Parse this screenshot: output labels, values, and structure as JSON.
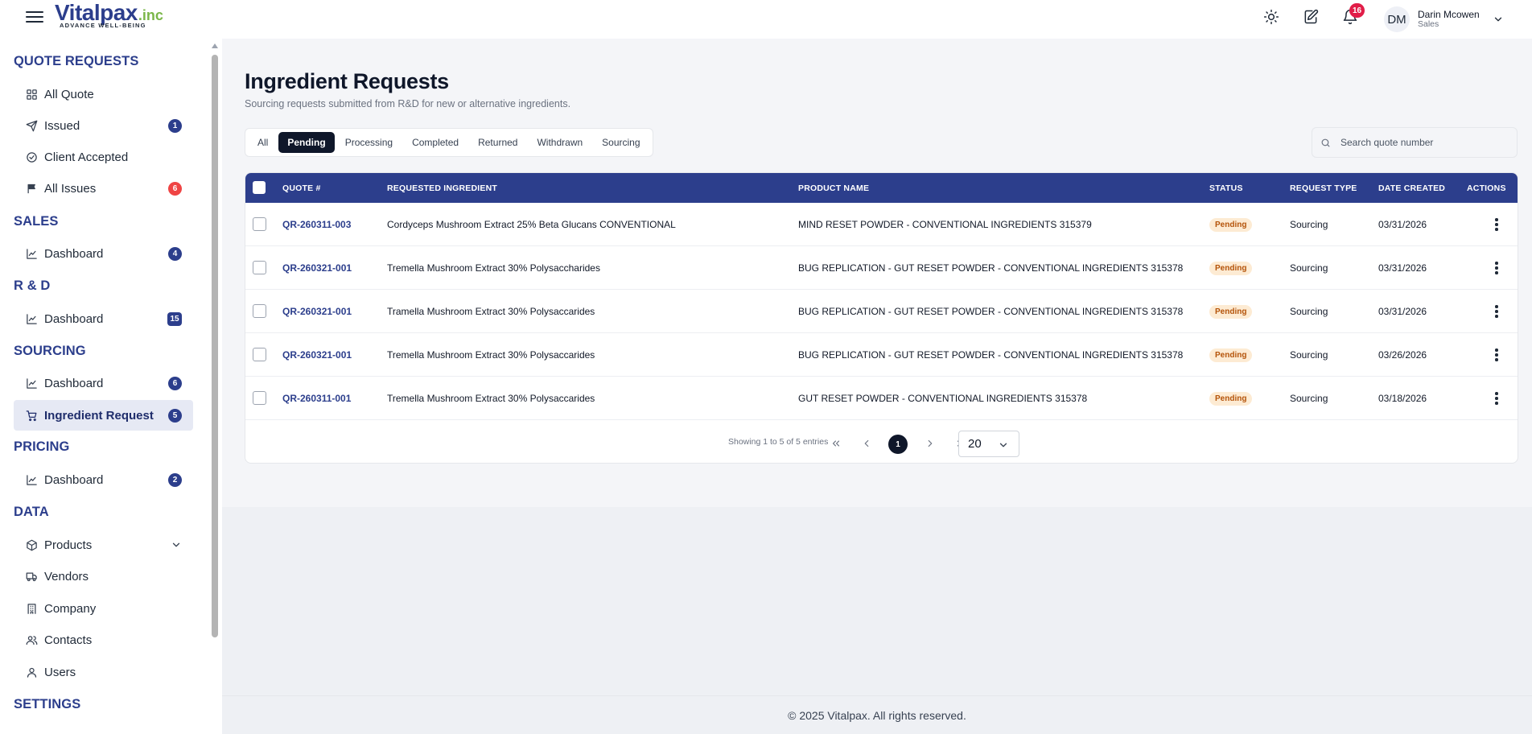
{
  "header": {
    "logo_text": "Vitalpax",
    "logo_suffix": ".inc",
    "logo_tagline": "ADVANCE WELL-BEING",
    "notifications_count": "16",
    "user_initials": "DM",
    "user_name": "Darin Mcowen",
    "user_role": "Sales"
  },
  "sidebar": {
    "sections": [
      {
        "title": "QUOTE REQUESTS"
      },
      {
        "title": "SALES"
      },
      {
        "title": "R & D"
      },
      {
        "title": "SOURCING"
      },
      {
        "title": "PRICING"
      },
      {
        "title": "DATA"
      },
      {
        "title": "SETTINGS"
      }
    ],
    "items": [
      {
        "label": "All Quote",
        "icon": "grid-icon"
      },
      {
        "label": "Issued",
        "icon": "send-icon",
        "badge": "1"
      },
      {
        "label": "Client Accepted",
        "icon": "check-circle-icon"
      },
      {
        "label": "All Issues",
        "icon": "flag-icon",
        "badge": "6"
      },
      {
        "label": "Dashboard",
        "icon": "chart-line-icon",
        "badge": "4"
      },
      {
        "label": "Dashboard",
        "icon": "chart-line-icon",
        "badge": "15"
      },
      {
        "label": "Dashboard",
        "icon": "chart-line-icon",
        "badge": "6"
      },
      {
        "label": "Ingredient Request",
        "icon": "cart-icon",
        "badge": "5"
      },
      {
        "label": "Dashboard",
        "icon": "chart-line-icon",
        "badge": "2"
      },
      {
        "label": "Products",
        "icon": "box-icon"
      },
      {
        "label": "Vendors",
        "icon": "truck-icon"
      },
      {
        "label": "Company",
        "icon": "building-icon"
      },
      {
        "label": "Contacts",
        "icon": "users-icon"
      },
      {
        "label": "Users",
        "icon": "user-icon"
      }
    ]
  },
  "main": {
    "title": "Ingredient Requests",
    "subtitle": "Sourcing requests submitted from R&D for new or alternative ingredients.",
    "tabs": [
      "All",
      "Pending",
      "Processing",
      "Completed",
      "Returned",
      "Withdrawn",
      "Sourcing"
    ],
    "active_tab": "Pending",
    "search_placeholder": "Search quote number",
    "columns": {
      "quote": "QUOTE #",
      "ingredient": "REQUESTED INGREDIENT",
      "product": "PRODUCT NAME",
      "status": "STATUS",
      "request_type": "REQUEST TYPE",
      "date_created": "DATE CREATED",
      "actions": "ACTIONS"
    },
    "rows": [
      {
        "quote": "QR-260311-003",
        "ingredient": "Cordyceps Mushroom Extract 25% Beta Glucans CONVENTIONAL",
        "product": "MIND RESET POWDER - CONVENTIONAL INGREDIENTS 315379",
        "status": "Pending",
        "request_type": "Sourcing",
        "date": "03/31/2026"
      },
      {
        "quote": "QR-260321-001",
        "ingredient": "Tremella Mushroom Extract 30% Polysaccharides",
        "product": "BUG REPLICATION - GUT RESET POWDER - CONVENTIONAL INGREDIENTS 315378",
        "status": "Pending",
        "request_type": "Sourcing",
        "date": "03/31/2026"
      },
      {
        "quote": "QR-260321-001",
        "ingredient": "Tramella Mushroom Extract 30% Polysaccarides",
        "product": "BUG REPLICATION - GUT RESET POWDER - CONVENTIONAL INGREDIENTS 315378",
        "status": "Pending",
        "request_type": "Sourcing",
        "date": "03/31/2026"
      },
      {
        "quote": "QR-260321-001",
        "ingredient": "Tremella Mushroom Extract 30% Polysaccarides",
        "product": "BUG REPLICATION - GUT RESET POWDER - CONVENTIONAL INGREDIENTS 315378",
        "status": "Pending",
        "request_type": "Sourcing",
        "date": "03/26/2026"
      },
      {
        "quote": "QR-260311-001",
        "ingredient": "Tremella Mushroom Extract 30% Polysaccarides",
        "product": "GUT RESET POWDER - CONVENTIONAL INGREDIENTS 315378",
        "status": "Pending",
        "request_type": "Sourcing",
        "date": "03/18/2026"
      }
    ],
    "pagination": {
      "info": "Showing 1 to 5 of 5 entries",
      "current_page": "1",
      "page_size": "20"
    }
  },
  "footer": {
    "text": "© 2025 Vitalpax. All rights reserved."
  },
  "colors": {
    "brand": "#2c3e8c",
    "accent_green": "#7ab648",
    "notification": "#e11d48",
    "pending_bg": "#fdebd3",
    "pending_text": "#b45309"
  }
}
